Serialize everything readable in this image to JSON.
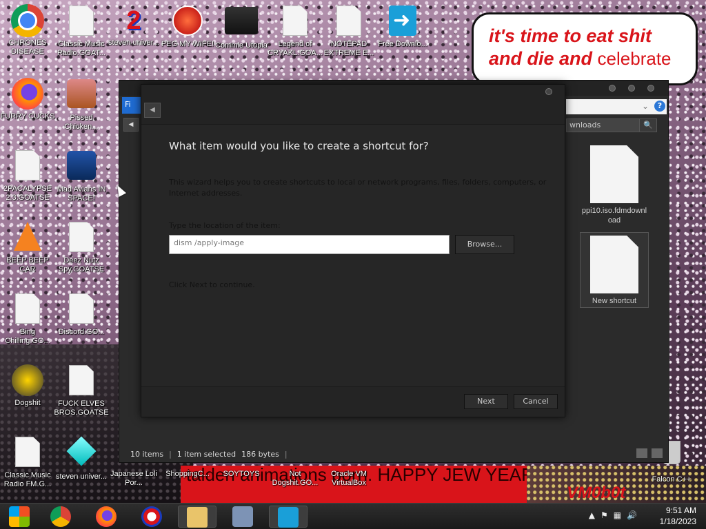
{
  "desktop": {
    "bubble": {
      "line1": "it's time to eat shit",
      "line2_bold": "and die and",
      "line2_rest": "celebrate"
    },
    "banner_text": "talden animations porn. HAPPY JEW YEAR!",
    "vm_text": "VM0b0t",
    "icons": [
      {
        "label": "CHRONES DISEASE",
        "icon": "chrome-icon"
      },
      {
        "label": "Classic Music Radio.GOAT...",
        "icon": "file-icon"
      },
      {
        "label": "steven univer...",
        "icon": "red-2-icon"
      },
      {
        "label": "PEG MY WIFE!",
        "icon": "peggle-icon"
      },
      {
        "label": "Commie Utopia",
        "icon": "commie-icon"
      },
      {
        "label": "Legend of CRYAKL.GOA...",
        "icon": "file-icon"
      },
      {
        "label": "NOTEPAD EXTREME E...",
        "icon": "file-icon"
      },
      {
        "label": "Free Downlo...",
        "icon": "free-download-icon"
      },
      {
        "label": "FURRY CUCKS",
        "icon": "firefox-icon"
      },
      {
        "label": "Pissed Chicken...",
        "icon": "angry-birds-icon"
      },
      {
        "label": "2PACALYPSE 2.3.GOATSE",
        "icon": "file-icon"
      },
      {
        "label": "Mad Avians IN SPACE!",
        "icon": "angry-birds-space-icon"
      },
      {
        "label": "BEEP BEEP CAR",
        "icon": "vlc-icon"
      },
      {
        "label": "Deez Nutz Spy.GOATSE",
        "icon": "file-icon"
      },
      {
        "label": "Bing Chilling.GO...",
        "icon": "file-icon"
      },
      {
        "label": "Discord.GO...",
        "icon": "file-icon"
      },
      {
        "label": "Dogshit",
        "icon": "dogshit-icon"
      },
      {
        "label": "FUCK ELVES BROS.GOATSE",
        "icon": "file-icon"
      },
      {
        "label": "Classic Music Radio FM.G...",
        "icon": "file-icon"
      },
      {
        "label": "steven univer...",
        "icon": "gem-icon"
      },
      {
        "label": "Japanese Loli Por...",
        "icon": "file-icon"
      },
      {
        "label": "ShoppingC...",
        "icon": "file-icon"
      },
      {
        "label": "SOYTOYS",
        "icon": "file-icon"
      },
      {
        "label": "Not Dogshit.GO...",
        "icon": "file-icon"
      },
      {
        "label": "Oracle VM VirtualBox",
        "icon": "virtualbox-icon"
      },
      {
        "label": "Falcon C++",
        "icon": "recycle-bin-icon"
      }
    ]
  },
  "explorer": {
    "search_text": "wnloads",
    "search_button": "🔍",
    "left_tab_label": "Fi",
    "files": [
      {
        "name": "ppi10.iso.fdmdownload"
      },
      {
        "name": "New shortcut"
      }
    ],
    "status": {
      "items": "10 items",
      "selected": "1 item selected",
      "size": "186 bytes"
    }
  },
  "wizard": {
    "heading": "What item would you like to create a shortcut for?",
    "description": "This wizard helps you to create shortcuts to local or network programs, files, folders, computers, or Internet addresses.",
    "location_label": "Type the location of the item:",
    "location_value": "dism /apply-image",
    "browse_label": "Browse...",
    "continue_text": "Click Next to continue.",
    "next_label": "Next",
    "cancel_label": "Cancel"
  },
  "taskbar": {
    "time": "9:51 AM",
    "date": "1/18/2023",
    "apps": [
      "start-orb-icon",
      "chrome-icon",
      "firefox-icon",
      "obama-icon",
      "file-explorer-icon",
      "virtualbox-icon",
      "free-download-icon"
    ]
  }
}
